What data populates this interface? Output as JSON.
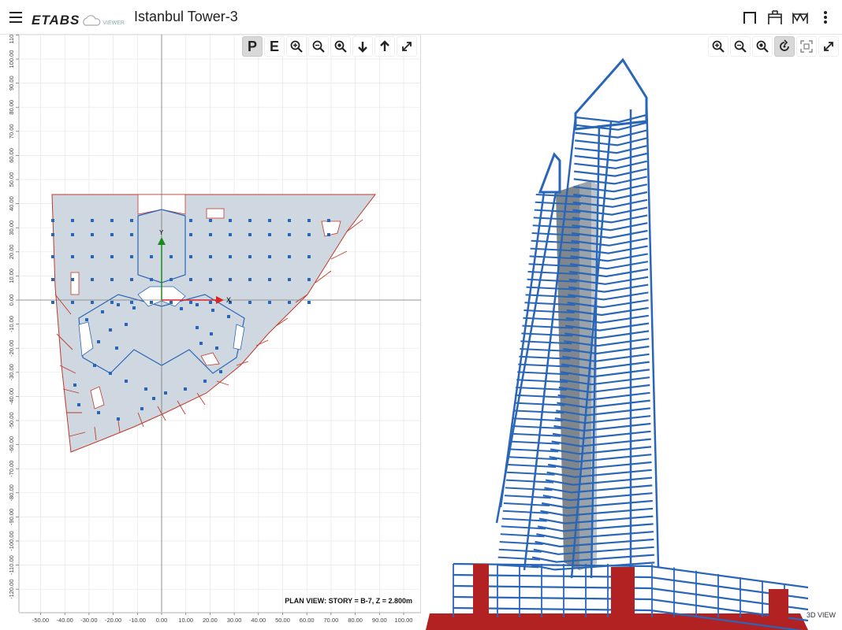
{
  "app": {
    "logo": "ETABS",
    "logo_sub": "VIEWER",
    "title": "Istanbul Tower-3"
  },
  "top_actions": [
    {
      "name": "frame-view-icon"
    },
    {
      "name": "structure-view-icon"
    },
    {
      "name": "truss-view-icon"
    },
    {
      "name": "more-options-icon"
    }
  ],
  "plan_toolbar": [
    {
      "name": "plan-mode-button",
      "label": "P",
      "active": true
    },
    {
      "name": "elevation-mode-button",
      "label": "E",
      "active": false
    },
    {
      "name": "zoom-in-button",
      "label": "",
      "icon": "zoom-in-icon"
    },
    {
      "name": "zoom-out-button",
      "label": "",
      "icon": "zoom-out-icon"
    },
    {
      "name": "zoom-fit-button",
      "label": "",
      "icon": "zoom-fit-icon"
    },
    {
      "name": "story-down-button",
      "label": "",
      "icon": "arrow-down-icon"
    },
    {
      "name": "story-up-button",
      "label": "",
      "icon": "arrow-up-icon"
    },
    {
      "name": "expand-plan-button",
      "label": "",
      "icon": "expand-icon"
    }
  ],
  "view3d_toolbar": [
    {
      "name": "zoom-in-3d-button",
      "icon": "zoom-in-icon"
    },
    {
      "name": "zoom-out-3d-button",
      "icon": "zoom-out-icon"
    },
    {
      "name": "zoom-fit-3d-button",
      "icon": "zoom-fit-icon"
    },
    {
      "name": "rotate-3d-button",
      "icon": "rotate-icon",
      "active": true
    },
    {
      "name": "pan-3d-button",
      "icon": "pan-icon"
    },
    {
      "name": "expand-3d-button",
      "icon": "expand-icon"
    }
  ],
  "plan": {
    "caption": "PLAN VIEW: STORY = B-7, Z = 2.800m",
    "x_axis_label": "X",
    "y_axis_label": "Y",
    "x_ticks": [
      "-50.00",
      "-40.00",
      "-30.00",
      "-20.00",
      "-10.00",
      "0.00",
      "10.00",
      "20.00",
      "30.00",
      "40.00",
      "50.00",
      "60.00",
      "70.00",
      "80.00",
      "90.00",
      "100.00"
    ],
    "y_ticks": [
      "110.00",
      "100.00",
      "90.00",
      "80.00",
      "70.00",
      "60.00",
      "50.00",
      "40.00",
      "30.00",
      "20.00",
      "10.00",
      "0.00",
      "-10.00",
      "-20.00",
      "-30.00",
      "-40.00",
      "-50.00",
      "-60.00",
      "-70.00",
      "-80.00",
      "-90.00",
      "-100.00",
      "-110.00",
      "-120.00"
    ]
  },
  "view3d": {
    "caption": "3D VIEW"
  },
  "colors": {
    "frame": "#2a66b8",
    "slab": "#cfd8e0",
    "edge": "#c0392b",
    "core": "#9aa3aa",
    "podium": "#b22222"
  }
}
